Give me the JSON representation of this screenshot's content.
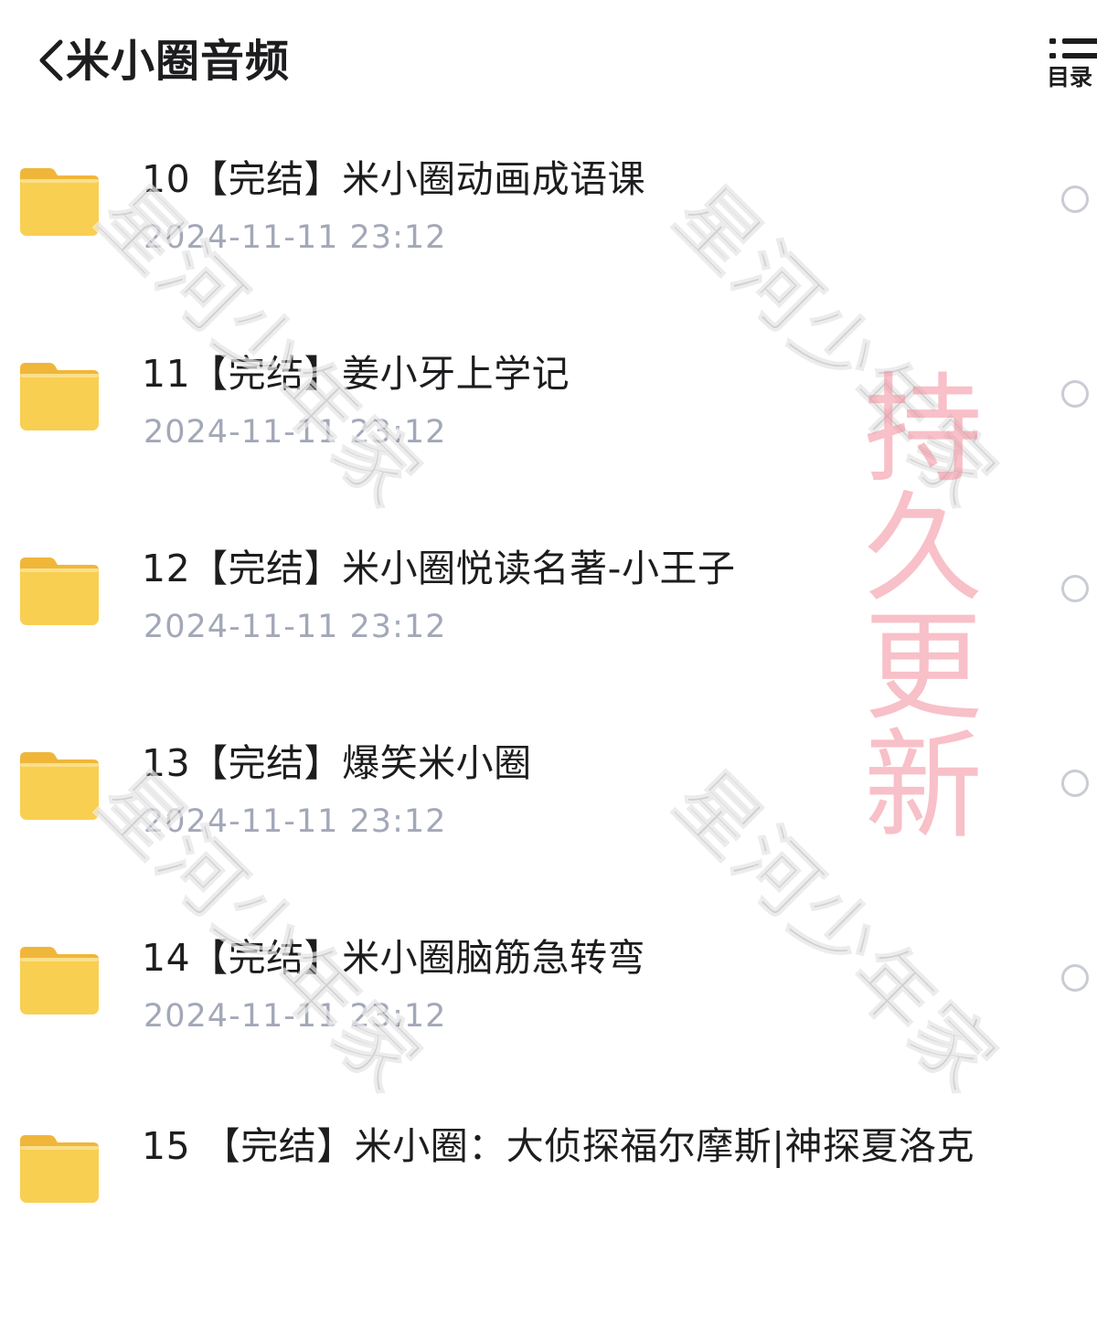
{
  "header": {
    "title": "米小圈音频",
    "toc_label": "目录"
  },
  "items": [
    {
      "title": "10【完结】米小圈动画成语课",
      "date": "2024-11-11 23:12"
    },
    {
      "title": "11【完结】姜小牙上学记",
      "date": "2024-11-11 23:12"
    },
    {
      "title": "12【完结】米小圈悦读名著-小王子",
      "date": "2024-11-11 23:12"
    },
    {
      "title": "13【完结】爆笑米小圈",
      "date": "2024-11-11 23:12"
    },
    {
      "title": "14【完结】米小圈脑筋急转弯",
      "date": "2024-11-11 23:12"
    },
    {
      "title": "15 【完结】米小圈：大侦探福尔摩斯|神探夏洛克",
      "date": ""
    }
  ],
  "watermark": {
    "text": "星河少年家",
    "banner": "持久更新"
  },
  "colors": {
    "folder": "#f9cf52",
    "date": "#a3a8b8",
    "banner": "#f28c9b"
  }
}
